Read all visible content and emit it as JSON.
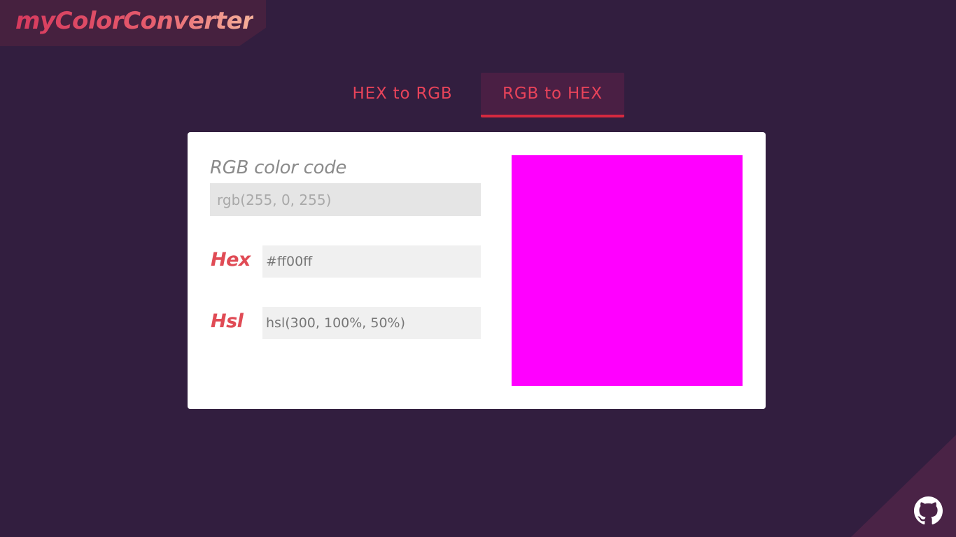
{
  "app": {
    "logo_text": "myColorConverter"
  },
  "tabs": [
    {
      "label": "HEX to RGB",
      "active": false
    },
    {
      "label": "RGB to HEX",
      "active": true
    }
  ],
  "converter": {
    "input_label": "RGB color code",
    "input_placeholder": "rgb(255, 0, 255)",
    "input_value": "",
    "hex_label": "Hex",
    "hex_value": "#ff00ff",
    "hsl_label": "Hsl",
    "hsl_value": "hsl(300, 100%, 50%)",
    "swatch_color": "#ff00ff"
  },
  "footer": {
    "github_icon": "github-icon"
  },
  "colors": {
    "background": "#321e3f",
    "accent": "#e8435a",
    "active_tab_underline": "#d5293f"
  }
}
